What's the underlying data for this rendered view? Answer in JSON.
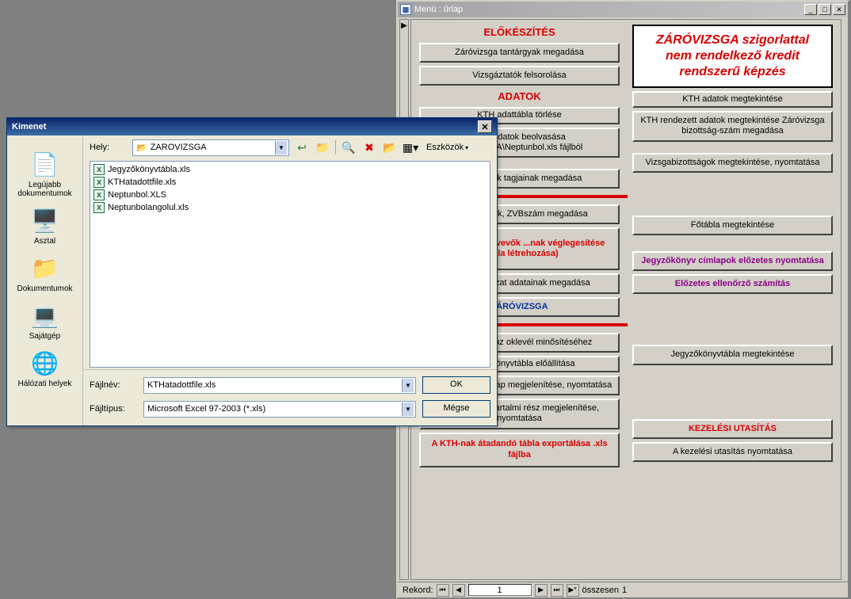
{
  "form": {
    "title": "Menü : űrlap",
    "sections": {
      "prep": "ELŐKÉSZÍTÉS",
      "data": "ADATOK"
    },
    "banner": "ZÁRÓVIZSGA szigorlattal nem rendelkező kredit rendszerű képzés",
    "buttons": {
      "b1": "Záróvizsga tantárgyak megadása",
      "b2": "Vizsgáztatók felsorolása",
      "b3": "KTH adattábla törlése",
      "b4": "KTH adatok beolvasása ...OVIZSGA\\Neptunbol.xls fájlból",
      "b5": "...zottságok tagjainak megadása",
      "b6": "...szék, elnök, ZVBszám megadása",
      "b7": "...vizsgán résztvevők ...nak véglegesítése ...ábla létrehozása)",
      "b8": "...szakdolgozat adatainak megadása",
      "b9": "ZÁRÓVIZSGA",
      "c1": "KTH adatok megtekintése",
      "c2": "KTH rendezett adatok megtekintése Záróvizsga bizottság-szám megadása",
      "c3": "Vizsgabizottságok megtekintése, nyomtatása",
      "c4": "Főtábla megtekintése",
      "c5": "Jegyzőkönyv címlapok előzetes nyomtatása",
      "c6": "Előzetes ellenőrző számítás",
      "d1": "Számítások az oklevél minősítéséhez",
      "d2": "Jegyzőkönyvtábla előállítása",
      "d3": "Jegyzőkönyv címlap megjelenítése, nyomtatása",
      "d4": "Jegyzőkönyv tartalmi rész megjelenítése, nyomtatása",
      "d5": "A KTH-nak átadandó tábla exportálása .xls fájlba",
      "e_hdr": "KEZELÉSI UTASÍTÁS",
      "e1": "A kezelési utasítás nyomtatása",
      "jkt": "Jegyzőkönyvtábla megtekintése"
    },
    "nav": {
      "label": "Rekord:",
      "value": "1",
      "total_label": "összesen",
      "total": "1"
    }
  },
  "dialog": {
    "title": "Kimenet",
    "look_in_label": "Hely:",
    "look_in_value": "ZAROVIZSGA",
    "tools_label": "Eszközök",
    "places": {
      "recent": "Legújabb dokumentumok",
      "desktop": "Asztal",
      "docs": "Dokumentumok",
      "mycomp": "Sajátgép",
      "network": "Hálózati helyek"
    },
    "files": [
      "Jegyzőkönyvtábla.xls",
      "KTHatadottfile.xls",
      "Neptunbol.XLS",
      "Neptunbolangolul.xls"
    ],
    "filename_label": "Fájlnév:",
    "filename_value": "KTHatadottfile.xls",
    "filetype_label": "Fájltípus:",
    "filetype_value": "Microsoft Excel 97-2003 (*.xls)",
    "ok": "OK",
    "cancel": "Mégse"
  }
}
